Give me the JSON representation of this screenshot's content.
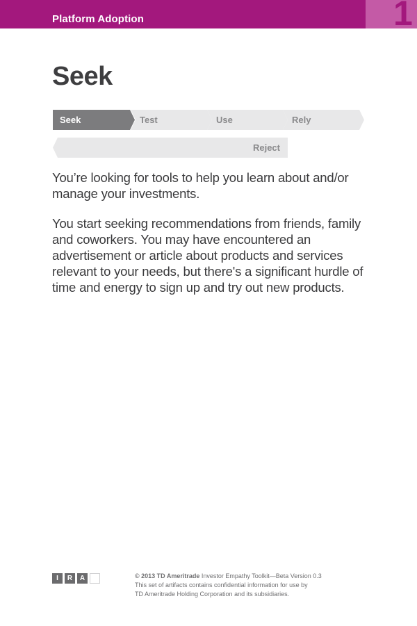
{
  "header": {
    "title": "Platform Adoption",
    "page_number": "1",
    "colors": {
      "bar": "#a3187d",
      "tab": "#c45aa6"
    }
  },
  "main": {
    "title": "Seek",
    "stages": [
      {
        "label": "Seek",
        "active": true
      },
      {
        "label": "Test",
        "active": false
      },
      {
        "label": "Use",
        "active": false
      },
      {
        "label": "Rely",
        "active": false
      }
    ],
    "reject_label": "Reject",
    "paragraphs": [
      "You’re looking for tools to help you learn about and/or manage your investments.",
      "You start seeking recommendations from friends, family and coworkers. You may have encountered an advertisement or article about products and services relevant to your needs, but there's a significant hurdle of time and energy to sign up and try out new products."
    ]
  },
  "footer": {
    "logo_letters": [
      "I",
      "R",
      "A"
    ],
    "copyright": "© 2013 TD Ameritrade",
    "product": " Investor Empathy Toolkit—Beta Version 0.3",
    "line2": "This set of artifacts contains confidential information for use by",
    "line3": "TD Ameritrade Holding Corporation and its subsidiaries."
  }
}
